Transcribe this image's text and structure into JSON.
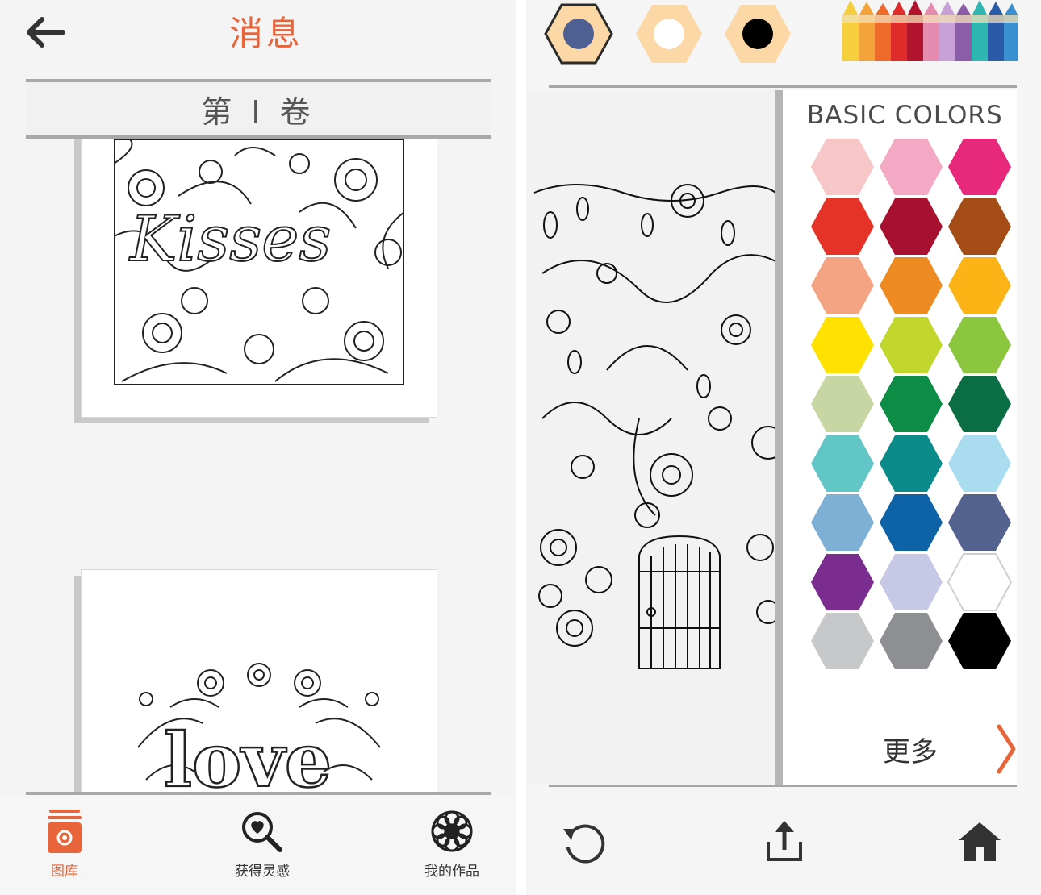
{
  "left_screen": {
    "header": {
      "title": "消息"
    },
    "volume": {
      "label": "第 I 卷"
    },
    "cards": [
      {
        "art_text": "Kisses"
      },
      {
        "art_text": "love"
      }
    ],
    "tabs": [
      {
        "label": "图库",
        "icon": "gallery-icon",
        "active": true
      },
      {
        "label": "获得灵感",
        "icon": "inspiration-search-icon",
        "active": false
      },
      {
        "label": "我的作品",
        "icon": "my-works-flower-icon",
        "active": false
      }
    ],
    "accent_color": "#e8643a"
  },
  "right_screen": {
    "recent_colors": [
      {
        "name": "recent-color-navy",
        "color": "#4e5f93",
        "selected": true
      },
      {
        "name": "recent-color-white",
        "color": "#ffffff",
        "selected": false
      },
      {
        "name": "recent-color-black",
        "color": "#000000",
        "selected": false
      }
    ],
    "palette": {
      "title": "BASIC COLORS",
      "more_label": "更多",
      "colors": [
        "#f7c6c6",
        "#f3a9c4",
        "#e8287a",
        "#e63328",
        "#a8102f",
        "#a44c16",
        "#f5a483",
        "#ed8a22",
        "#fbb316",
        "#ffe100",
        "#c2d72e",
        "#8cc63f",
        "#c7d6a3",
        "#0d8c46",
        "#0a6d43",
        "#62c6c6",
        "#0b8a8a",
        "#a9dcef",
        "#7eb0d5",
        "#0e62a6",
        "#54628f",
        "#7b2c8f",
        "#c7c7e6",
        "#ffffff",
        "#c7c8ca",
        "#8e8f92",
        "#000000"
      ]
    },
    "bottom_actions": [
      {
        "name": "undo-icon"
      },
      {
        "name": "share-icon"
      },
      {
        "name": "home-icon"
      }
    ]
  }
}
